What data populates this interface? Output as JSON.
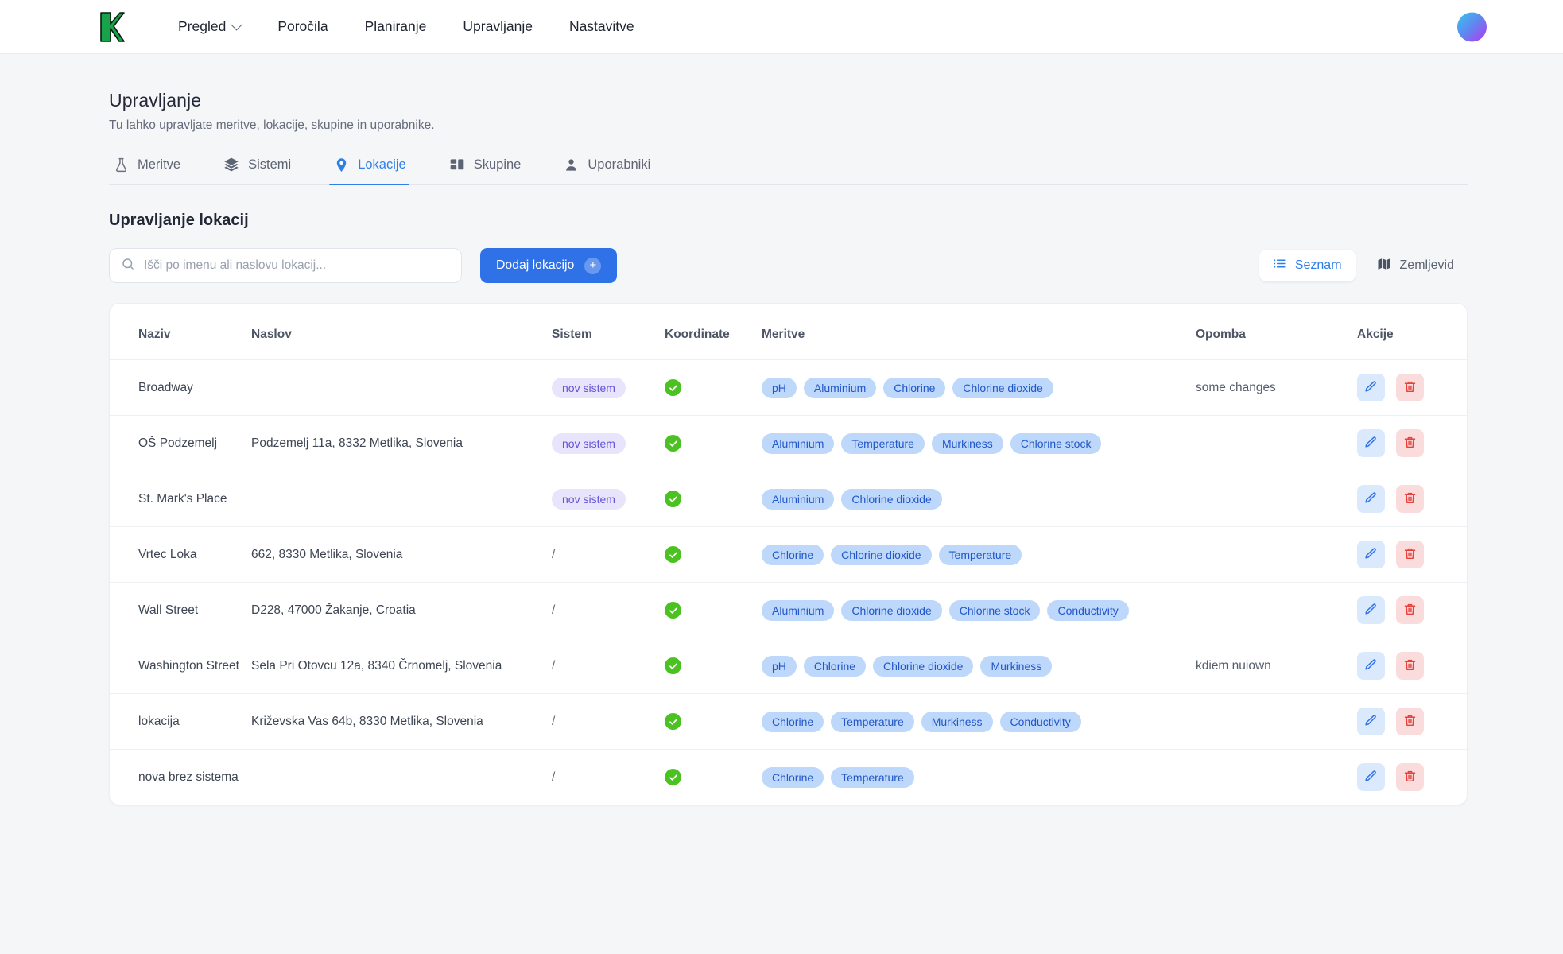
{
  "header": {
    "logo_alt": "K",
    "nav": [
      {
        "label": "Pregled",
        "has_caret": true
      },
      {
        "label": "Poročila",
        "has_caret": false
      },
      {
        "label": "Planiranje",
        "has_caret": false
      },
      {
        "label": "Upravljanje",
        "has_caret": false
      },
      {
        "label": "Nastavitve",
        "has_caret": false
      }
    ]
  },
  "page": {
    "title": "Upravljanje",
    "subtitle": "Tu lahko upravljate meritve, lokacije, skupine in uporabnike."
  },
  "tabs": [
    {
      "label": "Meritve",
      "icon": "flask-icon",
      "active": false
    },
    {
      "label": "Sistemi",
      "icon": "layers-icon",
      "active": false
    },
    {
      "label": "Lokacije",
      "icon": "map-pin-icon",
      "active": true
    },
    {
      "label": "Skupine",
      "icon": "grid-icon",
      "active": false
    },
    {
      "label": "Uporabniki",
      "icon": "user-icon",
      "active": false
    }
  ],
  "section": {
    "title": "Upravljanje lokacij"
  },
  "search": {
    "placeholder": "Išči po imenu ali naslovu lokacij...",
    "value": ""
  },
  "add_button": {
    "label": "Dodaj lokacijo",
    "icon": "plus-icon"
  },
  "view_toggle": [
    {
      "label": "Seznam",
      "icon": "list-icon",
      "active": true
    },
    {
      "label": "Zemljevid",
      "icon": "map-icon",
      "active": false
    }
  ],
  "table": {
    "columns": [
      "Naziv",
      "Naslov",
      "Sistem",
      "Koordinate",
      "Meritve",
      "Opomba",
      "Akcije"
    ],
    "no_system_placeholder": "/",
    "rows": [
      {
        "naziv": "Broadway",
        "naslov": "",
        "sistem": "nov sistem",
        "koordinate": true,
        "meritve": [
          "pH",
          "Aluminium",
          "Chlorine",
          "Chlorine dioxide"
        ],
        "opomba": "some changes"
      },
      {
        "naziv": "OŠ Podzemelj",
        "naslov": "Podzemelj 11a, 8332 Metlika, Slovenia",
        "sistem": "nov sistem",
        "koordinate": true,
        "meritve": [
          "Aluminium",
          "Temperature",
          "Murkiness",
          "Chlorine stock"
        ],
        "opomba": ""
      },
      {
        "naziv": "St. Mark's Place",
        "naslov": "",
        "sistem": "nov sistem",
        "koordinate": true,
        "meritve": [
          "Aluminium",
          "Chlorine dioxide"
        ],
        "opomba": ""
      },
      {
        "naziv": "Vrtec Loka",
        "naslov": "662, 8330 Metlika, Slovenia",
        "sistem": "/",
        "koordinate": true,
        "meritve": [
          "Chlorine",
          "Chlorine dioxide",
          "Temperature"
        ],
        "opomba": ""
      },
      {
        "naziv": "Wall Street",
        "naslov": "D228, 47000 Žakanje, Croatia",
        "sistem": "/",
        "koordinate": true,
        "meritve": [
          "Aluminium",
          "Chlorine dioxide",
          "Chlorine stock",
          "Conductivity"
        ],
        "opomba": ""
      },
      {
        "naziv": "Washington Street",
        "naslov": "Sela Pri Otovcu 12a, 8340 Črnomelj, Slovenia",
        "sistem": "/",
        "koordinate": true,
        "meritve": [
          "pH",
          "Chlorine",
          "Chlorine dioxide",
          "Murkiness"
        ],
        "opomba": "kdiem nuiown"
      },
      {
        "naziv": "lokacija",
        "naslov": "Križevska Vas 64b, 8330 Metlika, Slovenia",
        "sistem": "/",
        "koordinate": true,
        "meritve": [
          "Chlorine",
          "Temperature",
          "Murkiness",
          "Conductivity"
        ],
        "opomba": ""
      },
      {
        "naziv": "nova brez sistema",
        "naslov": "",
        "sistem": "/",
        "koordinate": true,
        "meritve": [
          "Chlorine",
          "Temperature"
        ],
        "opomba": ""
      }
    ],
    "row_actions": {
      "edit": "edit-icon",
      "delete": "delete-icon"
    }
  },
  "colors": {
    "accent": "#2f72e8",
    "tag_bg": "#bdd8fb",
    "tag_text": "#2256c9",
    "system_badge_bg": "#e7e4fb",
    "system_badge_text": "#6453d6",
    "check_green": "#4cc122",
    "delete_red": "#e8403a",
    "page_bg": "#f5f6f8"
  }
}
